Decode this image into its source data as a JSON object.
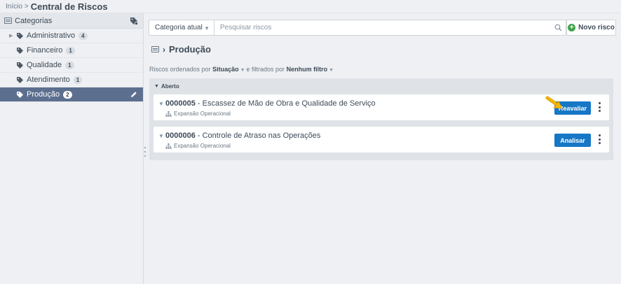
{
  "breadcrumb": {
    "home": "Início",
    "separator": ">",
    "title": "Central de Riscos"
  },
  "sidebar": {
    "header": "Categorias",
    "items": [
      {
        "label": "Administrativo",
        "count": "4",
        "expandable": true,
        "active": false
      },
      {
        "label": "Financeiro",
        "count": "1",
        "expandable": false,
        "active": false
      },
      {
        "label": "Qualidade",
        "count": "1",
        "expandable": false,
        "active": false
      },
      {
        "label": "Atendimento",
        "count": "1",
        "expandable": false,
        "active": false
      },
      {
        "label": "Produção",
        "count": "2",
        "expandable": false,
        "active": true
      }
    ]
  },
  "toolbar": {
    "scope_select": "Categoria atual",
    "search_placeholder": "Pesquisar riscos",
    "new_button": "Novo risco"
  },
  "page": {
    "title": "Produção",
    "sort_prefix": "Riscos ordenados por",
    "sort_field": "Situação",
    "filter_prefix": "e filtrados por",
    "filter_value": "Nenhum filtro"
  },
  "group": {
    "label": "Aberto",
    "risks": [
      {
        "code": "0000005",
        "title": "- Escassez de Mão de Obra e Qualidade de Serviço",
        "area": "Expansão Operacional",
        "action": "Reavaliar"
      },
      {
        "code": "0000006",
        "title": "- Controle de Atraso nas Operações",
        "area": "Expansão Operacional",
        "action": "Analisar"
      }
    ]
  },
  "colors": {
    "accent": "#1677c6",
    "active_item": "#5c6f8f",
    "add": "#3fa44b",
    "pointer": "#f2b705"
  }
}
